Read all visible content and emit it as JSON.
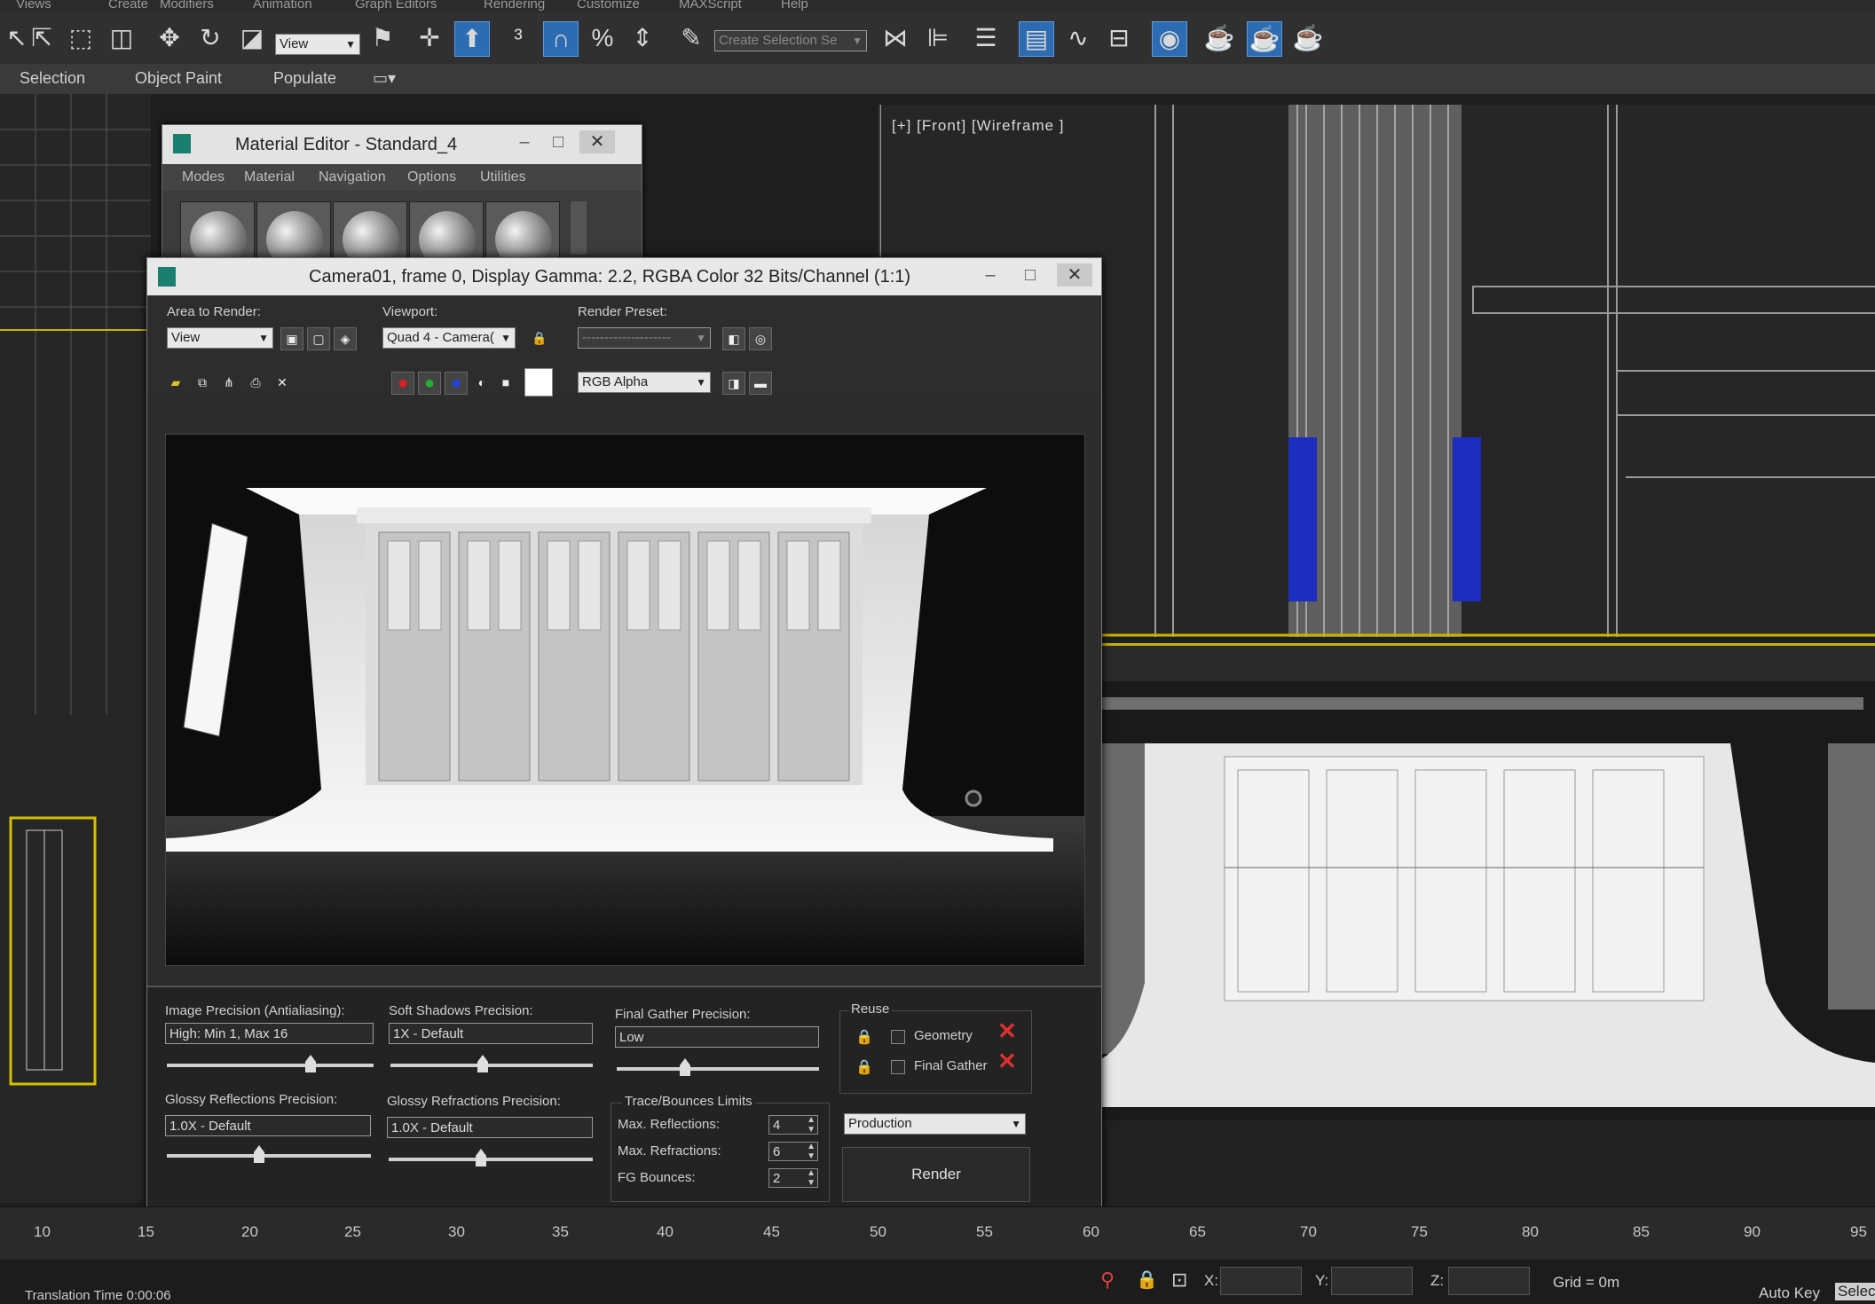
{
  "menubar": {
    "items": [
      "Views",
      "Create",
      "Modifiers",
      "Animation",
      "Graph Editors",
      "Rendering",
      "Customize",
      "MAXScript",
      "Help"
    ]
  },
  "toolbar": {
    "view_select": "View",
    "selection_set": "Create Selection Se",
    "icons": [
      "undo-icon",
      "select-icon",
      "select-by-name-icon",
      "rect-region-icon",
      "window-crossing-icon",
      "move-icon",
      "rotate-icon",
      "scale-icon",
      "reference-coord-icon",
      "select-link-icon",
      "pivot-icon",
      "keyboard-shortcut-icon",
      "snaps-icon",
      "angle-snap-icon",
      "percent-snap-icon",
      "spinner-snap-icon",
      "edit-named-sets-icon",
      "mirror-icon",
      "align-icon",
      "layer-icon",
      "graphite-icon",
      "curve-editor-icon",
      "schematic-icon",
      "material-editor-icon",
      "render-setup-icon",
      "rendered-frame-icon",
      "render-production-icon"
    ]
  },
  "ribbon": {
    "tabs": [
      "Selection",
      "Object Paint",
      "Populate"
    ]
  },
  "viewport_front": {
    "label": "[+] [Front] [Wireframe ]"
  },
  "material_editor": {
    "title": "Material Editor - Standard_4",
    "menu": [
      "Modes",
      "Material",
      "Navigation",
      "Options",
      "Utilities"
    ],
    "win_buttons": {
      "minimize": "–",
      "maximize": "□",
      "close": "✕"
    }
  },
  "render_window": {
    "title": "Camera01, frame 0, Display Gamma: 2.2, RGBA Color 32 Bits/Channel (1:1)",
    "win_buttons": {
      "minimize": "–",
      "maximize": "□",
      "close": "✕"
    },
    "area_to_render": {
      "label": "Area to Render:",
      "value": "View"
    },
    "viewport": {
      "label": "Viewport:",
      "value": "Quad 4 - Camera("
    },
    "render_preset": {
      "label": "Render Preset:",
      "value": "--------------------"
    },
    "channel": {
      "value": "RGB Alpha"
    },
    "image_precision": {
      "label": "Image Precision (Antialiasing):",
      "value": "High: Min 1, Max 16"
    },
    "soft_shadows": {
      "label": "Soft Shadows Precision:",
      "value": "1X - Default"
    },
    "final_gather": {
      "label": "Final Gather Precision:",
      "value": "Low"
    },
    "glossy_reflections": {
      "label": "Glossy Reflections Precision:",
      "value": "1.0X - Default"
    },
    "glossy_refractions": {
      "label": "Glossy Refractions Precision:",
      "value": "1.0X - Default"
    },
    "reuse": {
      "label": "Reuse",
      "geometry": "Geometry",
      "final_gather": "Final Gather"
    },
    "trace": {
      "label": "Trace/Bounces Limits",
      "max_reflections_label": "Max. Reflections:",
      "max_reflections": "4",
      "max_refractions_label": "Max. Refractions:",
      "max_refractions": "6",
      "fg_bounces_label": "FG Bounces:",
      "fg_bounces": "2"
    },
    "mode": "Production",
    "render_button": "Render"
  },
  "timeline": {
    "ticks": [
      "10",
      "15",
      "20",
      "25",
      "30",
      "35",
      "40",
      "45",
      "50",
      "55",
      "60",
      "65",
      "70",
      "75",
      "80",
      "85",
      "90",
      "95"
    ]
  },
  "status": {
    "message": "Translation Time  0:00:06",
    "x_label": "X:",
    "y_label": "Y:",
    "z_label": "Z:",
    "grid": "Grid = 0m",
    "auto_key": "Auto Key",
    "selected": "Selec"
  },
  "colors": {
    "accent": "#2d6bb3",
    "wire_yellow": "#c9b300",
    "wire_blue": "#1c2dbf",
    "close_red": "#e23030"
  }
}
